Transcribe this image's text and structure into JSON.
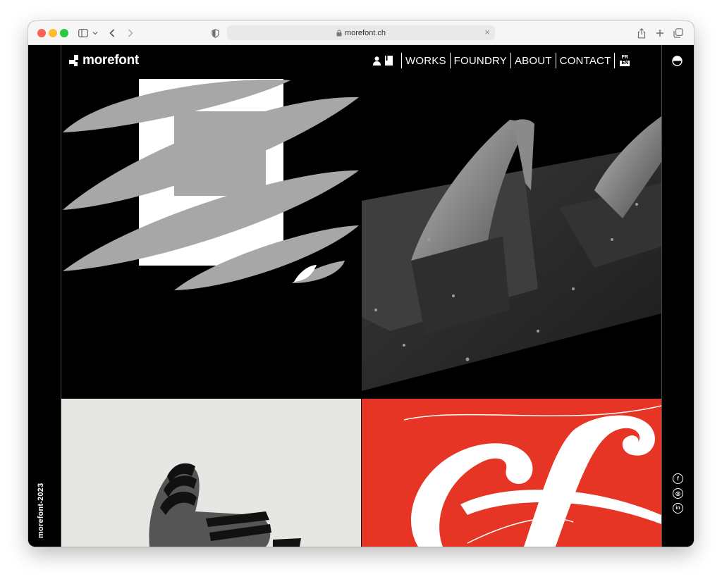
{
  "browser": {
    "url": "morefont.ch",
    "icons": [
      "sidebar-icon",
      "chevron-down-icon",
      "back-icon",
      "forward-icon",
      "shield-icon",
      "lock-icon",
      "close-icon",
      "share-icon",
      "new-tab-icon",
      "tabs-overview-icon"
    ]
  },
  "site": {
    "logo": "morefont",
    "nav": [
      "WORKS",
      "FOUNDRY",
      "ABOUT",
      "CONTACT"
    ],
    "lang": {
      "top": "FR",
      "bottom": "EN"
    },
    "header_icons": [
      "user-icon",
      "bookmark-icon",
      "contrast-toggle-icon"
    ],
    "year_label": "morefont-2023",
    "social": [
      {
        "name": "facebook-icon",
        "glyph": "f"
      },
      {
        "name": "instagram-icon",
        "glyph": "◎"
      },
      {
        "name": "linkedin-icon",
        "glyph": "in"
      }
    ],
    "colors": {
      "background": "#000000",
      "text": "#ffffff",
      "red_tile": "#e63524",
      "light_tile": "#e6e6e3"
    }
  }
}
